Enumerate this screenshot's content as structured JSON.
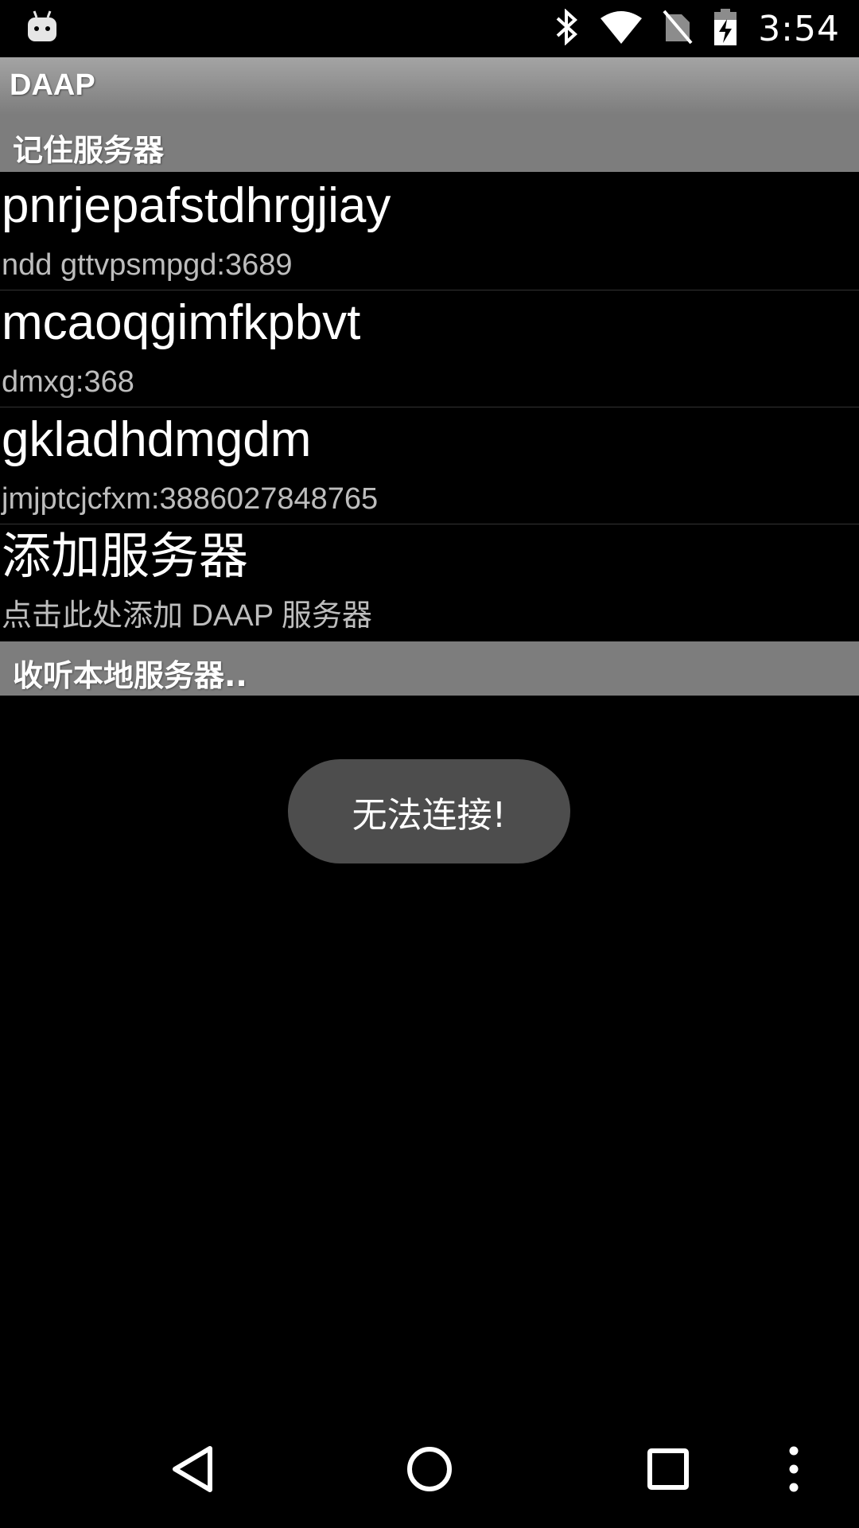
{
  "status_bar": {
    "time": "3:54",
    "icons": [
      "android-icon",
      "bluetooth-icon",
      "wifi-icon",
      "no-sim-icon",
      "battery-charging-icon"
    ]
  },
  "app": {
    "title": "DAAP"
  },
  "sections": {
    "remembered_servers": "记住服务器",
    "local_servers": "收听本地服务器.."
  },
  "servers": [
    {
      "name": "pnrjepafstdhrgjiay",
      "address": "ndd gttvpsmpgd:3689"
    },
    {
      "name": "mcaoqgimfkpbvt",
      "address": "dmxg:368"
    },
    {
      "name": "gkladhdmgdm",
      "address": "jmjptcjcfxm:3886027848765"
    }
  ],
  "add_server": {
    "title": "添加服务器",
    "subtitle": "点击此处添加 DAAP 服务器"
  },
  "toast": {
    "message": "无法连接!"
  },
  "nav_bar": {
    "icons": [
      "back-icon",
      "home-icon",
      "recents-icon",
      "overflow-menu-icon"
    ]
  }
}
